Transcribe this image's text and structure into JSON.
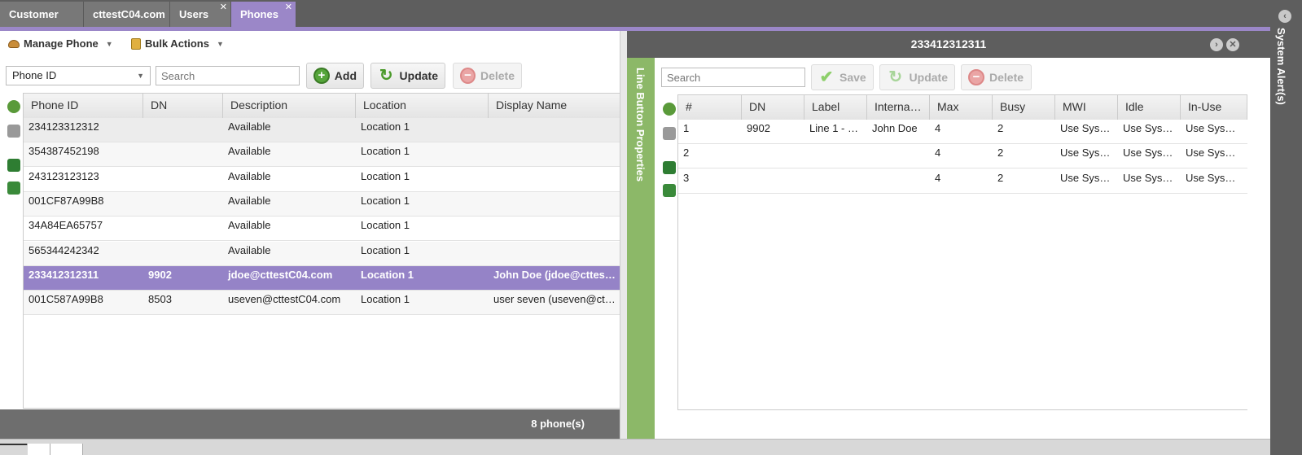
{
  "tabs": [
    {
      "label": "Customer List",
      "closable": false
    },
    {
      "label": "cttestC04.com",
      "closable": false
    },
    {
      "label": "Users",
      "closable": true
    },
    {
      "label": "Phones",
      "closable": true,
      "active": true
    }
  ],
  "system_alerts": {
    "label": "System Alert(s)"
  },
  "left": {
    "menu": {
      "manage_phone": "Manage Phone",
      "bulk_actions": "Bulk Actions"
    },
    "filter_select": "Phone ID",
    "search_placeholder": "Search",
    "buttons": {
      "add": "Add",
      "update": "Update",
      "delete": "Delete"
    },
    "columns": [
      "Phone ID",
      "DN",
      "Description",
      "Location",
      "Display Name"
    ],
    "rows": [
      {
        "phone_id": "234123312312",
        "dn": "",
        "description": "Available",
        "location": "Location 1",
        "display_name": ""
      },
      {
        "phone_id": "354387452198",
        "dn": "",
        "description": "Available",
        "location": "Location 1",
        "display_name": ""
      },
      {
        "phone_id": "243123123123",
        "dn": "",
        "description": "Available",
        "location": "Location 1",
        "display_name": ""
      },
      {
        "phone_id": "001CF87A99B8",
        "dn": "",
        "description": "Available",
        "location": "Location 1",
        "display_name": ""
      },
      {
        "phone_id": "34A84EA65757",
        "dn": "",
        "description": "Available",
        "location": "Location 1",
        "display_name": ""
      },
      {
        "phone_id": "565344242342",
        "dn": "",
        "description": "Available",
        "location": "Location 1",
        "display_name": ""
      },
      {
        "phone_id": "233412312311",
        "dn": "9902",
        "description": "jdoe@cttestC04.com",
        "location": "Location 1",
        "display_name": "John Doe (jdoe@cttes…",
        "selected": true
      },
      {
        "phone_id": "001C587A99B8",
        "dn": "8503",
        "description": "useven@cttestC04.com",
        "location": "Location 1",
        "display_name": "user seven (useven@ct…"
      }
    ],
    "footer_count": "8 phone(s)"
  },
  "right": {
    "title": "233412312311",
    "side_tab": "Line Button Properties",
    "search_placeholder": "Search",
    "buttons": {
      "save": "Save",
      "update": "Update",
      "delete": "Delete"
    },
    "columns": [
      "#",
      "DN",
      "Label",
      "Interna…",
      "Max",
      "Busy",
      "MWI",
      "Idle",
      "In-Use"
    ],
    "rows": [
      [
        "1",
        "9902",
        "Line 1 - …",
        "John Doe",
        "4",
        "2",
        "Use Sys…",
        "Use Sys…",
        "Use Sys…"
      ],
      [
        "2",
        "",
        "",
        "",
        "4",
        "2",
        "Use Sys…",
        "Use Sys…",
        "Use Sys…"
      ],
      [
        "3",
        "",
        "",
        "",
        "4",
        "2",
        "Use Sys…",
        "Use Sys…",
        "Use Sys…"
      ]
    ]
  },
  "colors": {
    "accent": "#9b87c8",
    "selected_row": "#9583c7",
    "side_tab": "#8cb868",
    "chrome": "#5e5e5e"
  }
}
